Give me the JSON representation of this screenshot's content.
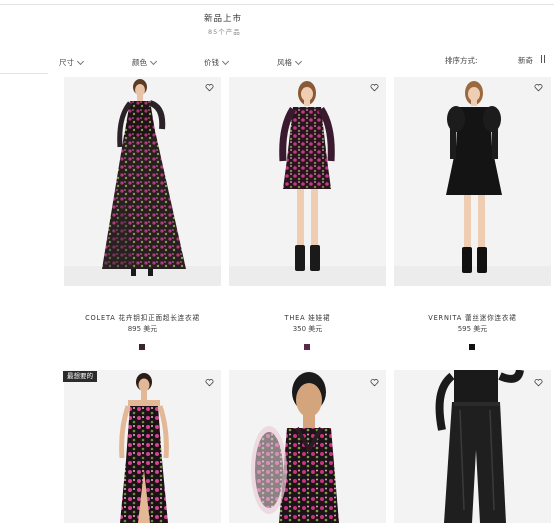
{
  "header": {
    "title": "新品上市",
    "count": "85个产品"
  },
  "filters": [
    {
      "label": "尺寸"
    },
    {
      "label": "颜色"
    },
    {
      "label": "价钱"
    },
    {
      "label": "风格"
    }
  ],
  "sort": {
    "label": "排序方式:",
    "value": "新奇"
  },
  "products": [
    {
      "name": "COLETA 花卉钥扣正面超长连衣裙",
      "price": "895 美元",
      "swatch_color": "#3a2430",
      "badge": ""
    },
    {
      "name": "THEA 娃娃裙",
      "price": "350 美元",
      "swatch_color": "#5a2848",
      "badge": ""
    },
    {
      "name": "VERNITA 蕾丝迷你连衣裙",
      "price": "595 美元",
      "swatch_color": "#111111",
      "badge": ""
    },
    {
      "name": "",
      "price": "",
      "swatch_color": "",
      "badge": "最想要的"
    },
    {
      "name": "",
      "price": "",
      "swatch_color": "",
      "badge": ""
    },
    {
      "name": "",
      "price": "",
      "swatch_color": "",
      "badge": ""
    }
  ],
  "icons": {
    "favorite": "heart-outline-icon",
    "filter_toggle": "chevron-down-icon",
    "view_toggle": "grid-view-icon"
  },
  "colors": {
    "text": "#333333",
    "badge_bg": "#2b2b2b",
    "image_bg": "#f3f3f3"
  }
}
